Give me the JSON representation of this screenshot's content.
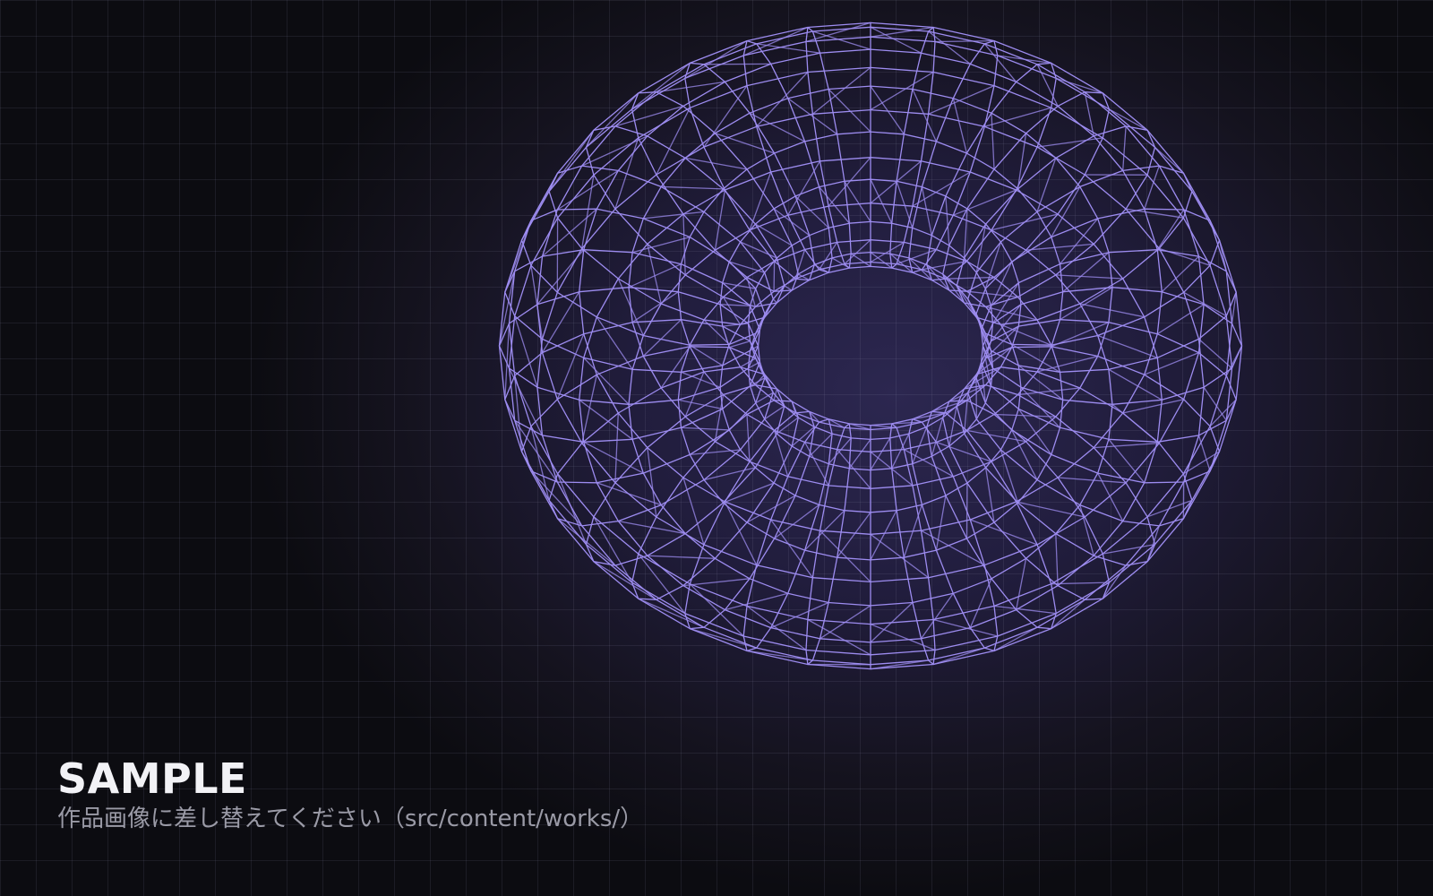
{
  "caption": {
    "title": "SAMPLE",
    "subtitle": "作品画像に差し替えてください（src/content/works/）"
  },
  "colors": {
    "background": "#0b0b10",
    "glow": "#2c2750",
    "wireframe": "#9d8cf0",
    "title": "#f2f2f6",
    "subtitle": "#9a9aa6"
  },
  "figure": {
    "type": "wireframe-torus",
    "major_segments": 36,
    "minor_segments": 16
  }
}
